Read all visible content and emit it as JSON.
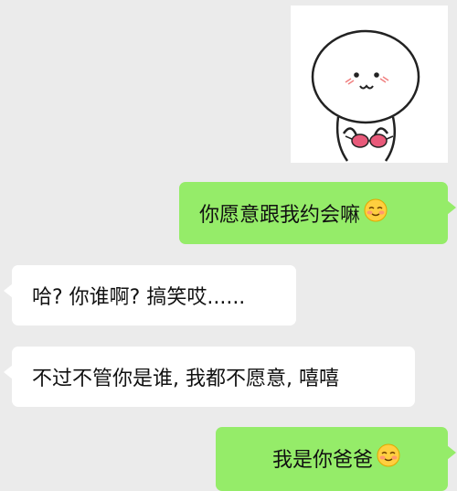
{
  "sticker": {
    "name": "white-blob-character-sticker"
  },
  "messages": [
    {
      "side": "right",
      "text": "你愿意跟我约会嘛",
      "emoji": "blush-smile-emoji"
    },
    {
      "side": "left",
      "text": "哈? 你谁啊? 搞笑哎......"
    },
    {
      "side": "left",
      "text": "不过不管你是谁, 我都不愿意, 嘻嘻"
    },
    {
      "side": "right",
      "text": "我是你爸爸",
      "emoji": "blush-smile-emoji"
    }
  ],
  "colors": {
    "background": "#ebebeb",
    "outgoing": "#95ec69",
    "incoming": "#ffffff"
  }
}
